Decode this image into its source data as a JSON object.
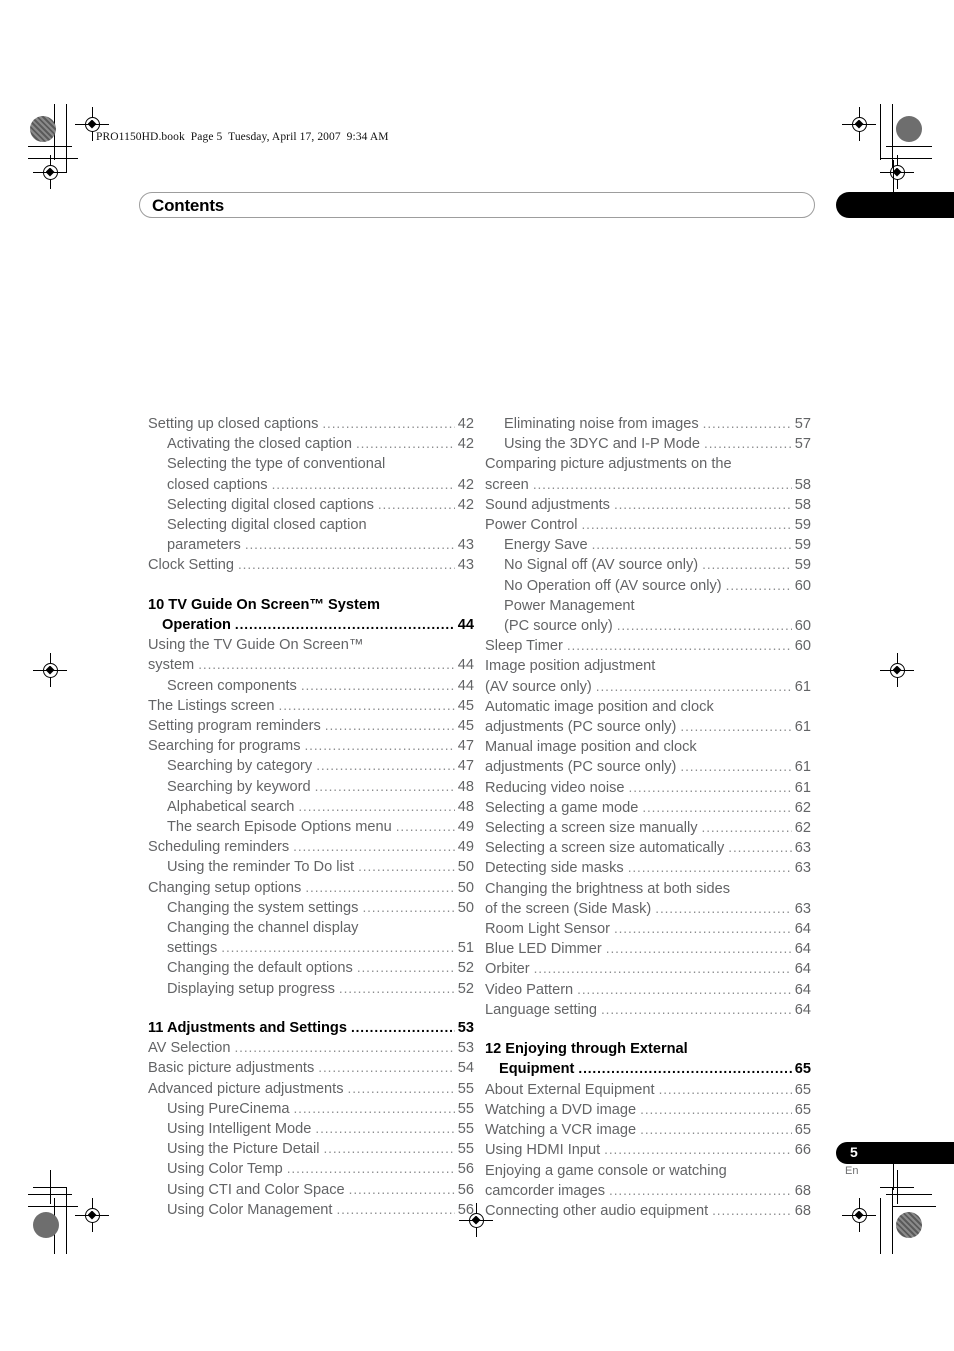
{
  "page": {
    "file_header": "PRO1150HD.book  Page 5  Tuesday, April 17, 2007  9:34 AM",
    "title": "Contents",
    "page_number": "5",
    "language_code": "En",
    "accent_black": "#000000",
    "body_text_color": "#636466"
  },
  "toc": {
    "left_column": [
      {
        "level": 0,
        "text": "Setting up closed captions",
        "page": "42"
      },
      {
        "level": 1,
        "text": "Activating the closed caption",
        "page": "42"
      },
      {
        "level": 1,
        "text": "Selecting the type of conventional",
        "page": "",
        "wrap": true
      },
      {
        "level": 1,
        "text": "closed captions",
        "page": "42",
        "cont": true
      },
      {
        "level": 1,
        "text": "Selecting digital closed captions",
        "page": "42"
      },
      {
        "level": 1,
        "text": "Selecting digital closed caption",
        "page": "",
        "wrap": true
      },
      {
        "level": 1,
        "text": "parameters",
        "page": "43",
        "cont": true
      },
      {
        "level": 0,
        "text": "Clock Setting",
        "page": "43"
      },
      {
        "level": -1,
        "text": "",
        "page": ""
      },
      {
        "level": 0,
        "head": true,
        "text": "10 TV Guide On Screen™ System",
        "page": "",
        "wrap": true
      },
      {
        "level": 0,
        "head": true,
        "text": "Operation",
        "page": "44",
        "headcont": true
      },
      {
        "level": 0,
        "text": "Using the TV Guide On Screen™",
        "page": "",
        "wrap": true
      },
      {
        "level": 0,
        "text": "system",
        "page": "44",
        "cont": true
      },
      {
        "level": 1,
        "text": "Screen components",
        "page": "44"
      },
      {
        "level": 0,
        "text": "The Listings screen",
        "page": "45"
      },
      {
        "level": 0,
        "text": "Setting program reminders",
        "page": "45"
      },
      {
        "level": 0,
        "text": "Searching for programs",
        "page": "47"
      },
      {
        "level": 1,
        "text": "Searching by category",
        "page": "47"
      },
      {
        "level": 1,
        "text": "Searching by keyword",
        "page": "48"
      },
      {
        "level": 1,
        "text": "Alphabetical search",
        "page": "48"
      },
      {
        "level": 1,
        "text": "The search Episode Options menu",
        "page": "49"
      },
      {
        "level": 0,
        "text": "Scheduling reminders",
        "page": "49"
      },
      {
        "level": 1,
        "text": "Using the reminder To Do list",
        "page": "50"
      },
      {
        "level": 0,
        "text": "Changing setup options",
        "page": "50"
      },
      {
        "level": 1,
        "text": "Changing the system settings",
        "page": "50"
      },
      {
        "level": 1,
        "text": "Changing the channel display",
        "page": "",
        "wrap": true
      },
      {
        "level": 1,
        "text": "settings",
        "page": "51",
        "cont": true
      },
      {
        "level": 1,
        "text": "Changing the default options",
        "page": "52"
      },
      {
        "level": 1,
        "text": "Displaying setup progress",
        "page": "52"
      },
      {
        "level": -1,
        "text": "",
        "page": ""
      },
      {
        "level": 0,
        "head": true,
        "text": "11 Adjustments and Settings",
        "page": "53"
      },
      {
        "level": 0,
        "text": "AV Selection",
        "page": "53"
      },
      {
        "level": 0,
        "text": "Basic picture adjustments",
        "page": "54"
      },
      {
        "level": 0,
        "text": "Advanced picture adjustments",
        "page": "55"
      },
      {
        "level": 1,
        "text": "Using PureCinema",
        "page": "55"
      },
      {
        "level": 1,
        "text": "Using Intelligent Mode",
        "page": "55"
      },
      {
        "level": 1,
        "text": "Using the Picture Detail",
        "page": "55"
      },
      {
        "level": 1,
        "text": "Using Color Temp",
        "page": "56"
      },
      {
        "level": 1,
        "text": "Using CTI and Color Space",
        "page": "56"
      },
      {
        "level": 1,
        "text": "Using Color Management",
        "page": "56"
      }
    ],
    "right_column": [
      {
        "level": 1,
        "text": "Eliminating noise from images",
        "page": "57"
      },
      {
        "level": 1,
        "text": "Using the 3DYC and I-P Mode",
        "page": "57"
      },
      {
        "level": 0,
        "text": "Comparing picture adjustments on the",
        "page": "",
        "wrap": true
      },
      {
        "level": 0,
        "text": "screen",
        "page": "58",
        "cont": true
      },
      {
        "level": 0,
        "text": "Sound adjustments",
        "page": "58"
      },
      {
        "level": 0,
        "text": "Power Control",
        "page": "59"
      },
      {
        "level": 1,
        "text": "Energy Save",
        "page": "59"
      },
      {
        "level": 1,
        "text": "No Signal off (AV source only)",
        "page": "59"
      },
      {
        "level": 1,
        "text": "No Operation off (AV source only)",
        "page": "60"
      },
      {
        "level": 1,
        "text": "Power Management",
        "page": "",
        "wrap": true
      },
      {
        "level": 1,
        "text": "(PC source only)",
        "page": "60",
        "cont": true
      },
      {
        "level": 0,
        "text": "Sleep Timer",
        "page": "60"
      },
      {
        "level": 0,
        "text": "Image position adjustment",
        "page": "",
        "wrap": true
      },
      {
        "level": 0,
        "text": "(AV source only)",
        "page": "61",
        "cont": true
      },
      {
        "level": 0,
        "text": "Automatic image position and clock",
        "page": "",
        "wrap": true
      },
      {
        "level": 0,
        "text": "adjustments (PC source only)",
        "page": "61",
        "cont": true
      },
      {
        "level": 0,
        "text": "Manual image position and clock",
        "page": "",
        "wrap": true
      },
      {
        "level": 0,
        "text": "adjustments (PC source only)",
        "page": "61",
        "cont": true
      },
      {
        "level": 0,
        "text": "Reducing video noise",
        "page": "61"
      },
      {
        "level": 0,
        "text": "Selecting a game mode",
        "page": "62"
      },
      {
        "level": 0,
        "text": "Selecting a screen size manually",
        "page": "62"
      },
      {
        "level": 0,
        "text": "Selecting a screen size automatically",
        "page": "63"
      },
      {
        "level": 0,
        "text": "Detecting side masks",
        "page": "63"
      },
      {
        "level": 0,
        "text": "Changing the brightness at both sides",
        "page": "",
        "wrap": true
      },
      {
        "level": 0,
        "text": "of the screen (Side Mask)",
        "page": "63",
        "cont": true
      },
      {
        "level": 0,
        "text": "Room Light Sensor",
        "page": "64"
      },
      {
        "level": 0,
        "text": "Blue LED Dimmer",
        "page": "64"
      },
      {
        "level": 0,
        "text": "Orbiter",
        "page": "64"
      },
      {
        "level": 0,
        "text": "Video Pattern",
        "page": "64"
      },
      {
        "level": 0,
        "text": "Language setting",
        "page": "64"
      },
      {
        "level": -1,
        "text": "",
        "page": ""
      },
      {
        "level": 0,
        "head": true,
        "text": "12 Enjoying through External",
        "page": "",
        "wrap": true
      },
      {
        "level": 0,
        "head": true,
        "text": "Equipment",
        "page": "65",
        "headcont": true
      },
      {
        "level": 0,
        "text": "About External Equipment",
        "page": "65"
      },
      {
        "level": 0,
        "text": "Watching a DVD image",
        "page": "65"
      },
      {
        "level": 0,
        "text": "Watching a VCR image",
        "page": "65"
      },
      {
        "level": 0,
        "text": "Using HDMI Input",
        "page": "66"
      },
      {
        "level": 0,
        "text": "Enjoying a game console or watching",
        "page": "",
        "wrap": true
      },
      {
        "level": 0,
        "text": "camcorder images",
        "page": "68",
        "cont": true
      },
      {
        "level": 0,
        "text": "Connecting other audio equipment",
        "page": "68"
      }
    ]
  }
}
